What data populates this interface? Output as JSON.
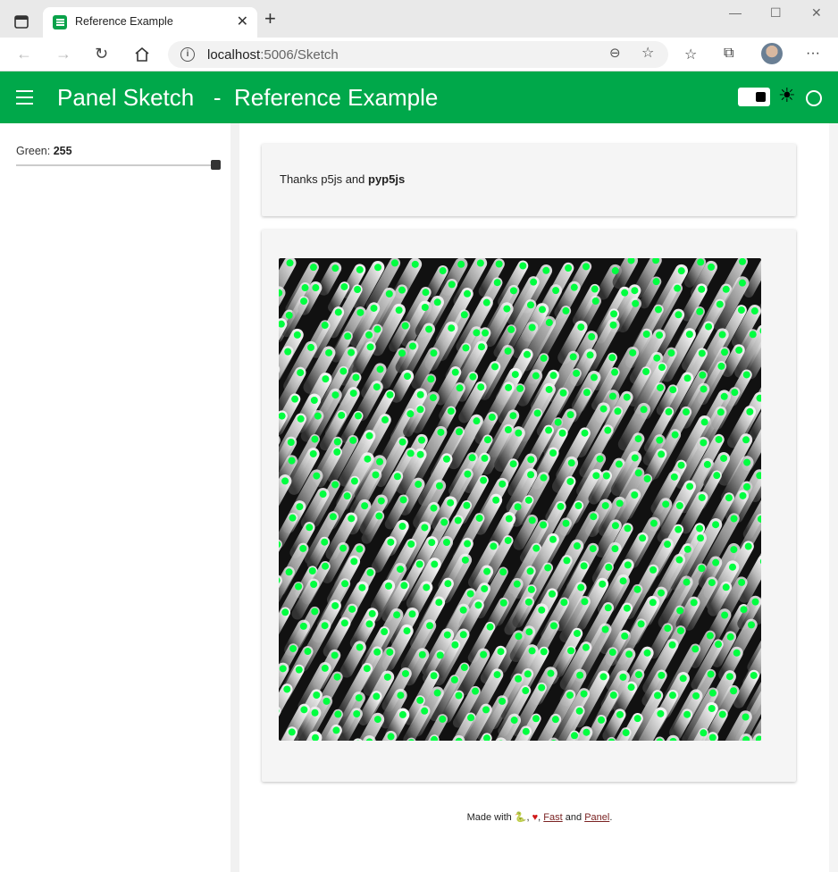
{
  "browser": {
    "tab_title": "Reference Example",
    "tab_close": "✕",
    "new_tab": "+",
    "url_host": "localhost",
    "url_path": ":5006/Sketch",
    "info_glyph": "i",
    "window_controls": {
      "minimize": "—",
      "maximize": "☐",
      "close": "✕"
    },
    "icons": [
      "back-icon",
      "forward-icon",
      "refresh-icon",
      "home-icon",
      "zoom-out-icon",
      "add-favorite-icon",
      "favorites-icon",
      "collections-icon",
      "profile-avatar",
      "more-icon"
    ]
  },
  "header": {
    "title": "Panel Sketch   -  Reference Example",
    "background": "#00a84a"
  },
  "sidebar": {
    "slider_label": "Green:",
    "slider_value": "255",
    "slider_fraction": 1.0
  },
  "main": {
    "thanks_prefix": "Thanks p5js and ",
    "thanks_bold": "pyp5js"
  },
  "sketch": {
    "background": "#111111",
    "point_color": "#00ff40"
  },
  "footer": {
    "made_with": "Made with",
    "comma": ",",
    "fast": "Fast",
    "and": "and",
    "panel": "Panel",
    "period": "."
  }
}
